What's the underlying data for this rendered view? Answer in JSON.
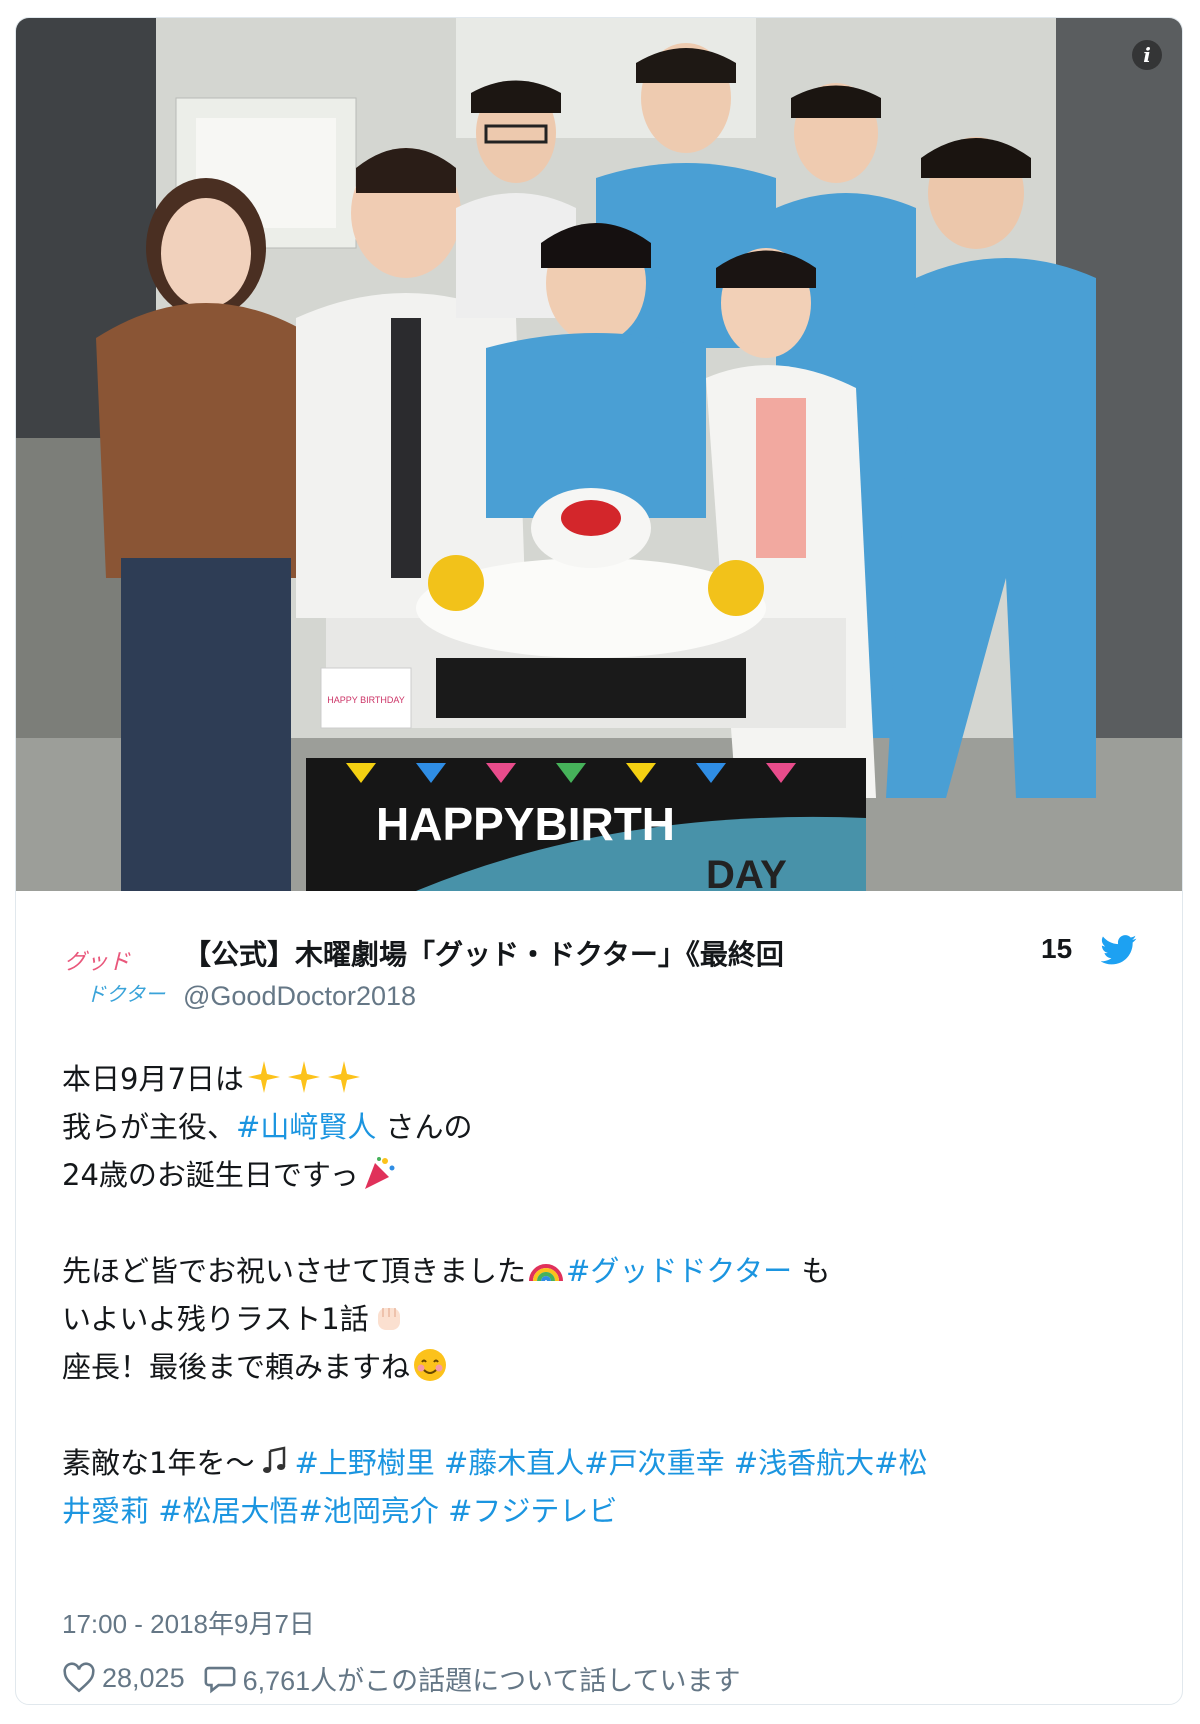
{
  "photo": {
    "description_icon": "info-icon",
    "banner_text_1": "HAPPYBIRTH",
    "banner_text_2": "DAY",
    "card_text": "HAPPY BIRTHDAY"
  },
  "account": {
    "name": "【公式】木曜劇場「グッド・ドクター」《最終回",
    "handle": "@GoodDoctor2018",
    "count": "15",
    "avatar_text_1": "グッド",
    "avatar_text_2": "ドクター"
  },
  "tweet": {
    "line1_text": "本日9月7日は",
    "line2_text": "我らが主役、",
    "line2_tag": "#山﨑賢人",
    "line2_suffix": " さんの",
    "line3_text": "24歳のお誕生日ですっ",
    "line4_text": "先ほど皆でお祝いさせて頂きました",
    "line4_tag": "#グッドドクター",
    "line4_suffix": " も",
    "line5_text": "いよいよ残りラスト1話",
    "line6_text": "座長！最後まで頼みますね",
    "line7_text": "素敵な1年を〜",
    "line7_tag1": "#上野樹里",
    "line7_tag2": " #藤木直人",
    "line7_tag3": "#戸次重幸",
    "line7_tag4": " #浅香航大",
    "line7_tag5": "#松",
    "line8_tag1": "井愛莉",
    "line8_tag2": " #松居大悟",
    "line8_tag3": "#池岡亮介",
    "line8_tag4": " #フジテレビ"
  },
  "timestamp": "17:00 - 2018年9月7日",
  "footer": {
    "likes": "28,025",
    "talk": "6,761人がこの話題について話しています"
  },
  "colors": {
    "link": "#1b95e0",
    "twitter_blue": "#1da1f2",
    "secondary_text": "#657786",
    "scrubs": "#4a9fd4"
  },
  "icons": [
    "info-icon",
    "twitter-bird-icon",
    "sparkles-icon",
    "party-popper-icon",
    "rainbow-icon",
    "fist-icon",
    "smile-icon",
    "music-note-icon",
    "heart-icon",
    "speech-bubble-icon"
  ]
}
